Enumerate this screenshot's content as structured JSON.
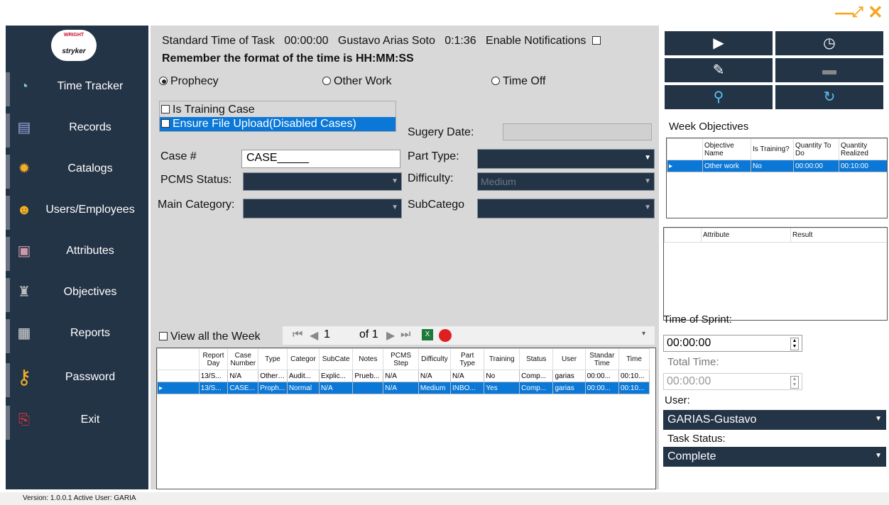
{
  "window": {
    "minimize_label": "—",
    "restore_label": "⤢",
    "close_label": "✕"
  },
  "logo": {
    "line1": "WRIGHT",
    "line2": "stryker"
  },
  "sidebar": {
    "items": [
      {
        "label": "Time Tracker",
        "icon": "clock-icon"
      },
      {
        "label": "Records",
        "icon": "records-icon"
      },
      {
        "label": "Catalogs",
        "icon": "gear-icon"
      },
      {
        "label": "Users/Employees",
        "icon": "users-icon"
      },
      {
        "label": "Attributes",
        "icon": "attributes-icon"
      },
      {
        "label": "Objectives",
        "icon": "objectives-icon"
      },
      {
        "label": "Reports",
        "icon": "reports-icon"
      },
      {
        "label": "Password",
        "icon": "key-icon"
      },
      {
        "label": "Exit",
        "icon": "exit-icon"
      }
    ]
  },
  "main": {
    "standard_time_label": "Standard Time of Task",
    "standard_time_value": "00:00:00",
    "user_name": "Gustavo  Arias Soto",
    "elapsed": "0:1:36",
    "enable_notifications": "Enable Notifications",
    "reminder": "Remember the format of the time is HH:MM:SS",
    "radios": [
      "Prophecy",
      "Other Work",
      "Time Off"
    ],
    "check_training": "Is Training Case",
    "check_upload": "Ensure File Upload(Disabled Cases)",
    "surgery_date_label": "Sugery Date:",
    "case_label": "Case #",
    "case_value": "CASE_____",
    "part_type_label": "Part Type:",
    "pcms_label": "PCMS Status:",
    "difficulty_label": "Difficulty:",
    "difficulty_value": "Medium",
    "main_category_label": "Main Category:",
    "subcategory_label": "SubCatego",
    "view_week": "View all the Week",
    "pager": {
      "current": "1",
      "of": "of 1"
    }
  },
  "grid": {
    "headers": [
      "Report Day",
      "Case Number",
      "Type",
      "Categor",
      "SubCate",
      "Notes",
      "PCMS Step",
      "Difficulty",
      "Part Type",
      "Training",
      "Status",
      "User",
      "Standar Time",
      "Time"
    ],
    "rows": [
      [
        "13/S...",
        "N/A",
        "Other ...",
        "Audit...",
        "Explic...",
        "Prueb...",
        "N/A",
        "N/A",
        "N/A",
        "No",
        "Comp...",
        "garias",
        "00:00...",
        "00:10..."
      ],
      [
        "13/S...",
        "CASE...",
        "Proph...",
        "Normal",
        "N/A",
        "",
        "N/A",
        "Medium",
        "INBO...",
        "Yes",
        "Comp...",
        "garias",
        "00:00...",
        "00:10..."
      ]
    ],
    "selected_row": 1
  },
  "right": {
    "week_objectives": "Week Objectives",
    "obj_headers": [
      "Objective Name",
      "Is Training?",
      "Quantity To Do",
      "Quantity Realized"
    ],
    "obj_row": [
      "Other work",
      "No",
      "00:00:00",
      "00:10:00"
    ],
    "attr_headers": [
      "Attribute",
      "Result"
    ],
    "time_of_sprint_label": "Time of Sprint:",
    "time_of_sprint_value": "00:00:00",
    "total_time_label": "Total Time:",
    "total_time_value": "00:00:00",
    "user_label": "User:",
    "user_value": "GARIAS-Gustavo",
    "task_status_label": "Task Status:",
    "task_status_value": "Complete"
  },
  "status_bar": "Version: 1.0.0.1  Active User: GARIA"
}
